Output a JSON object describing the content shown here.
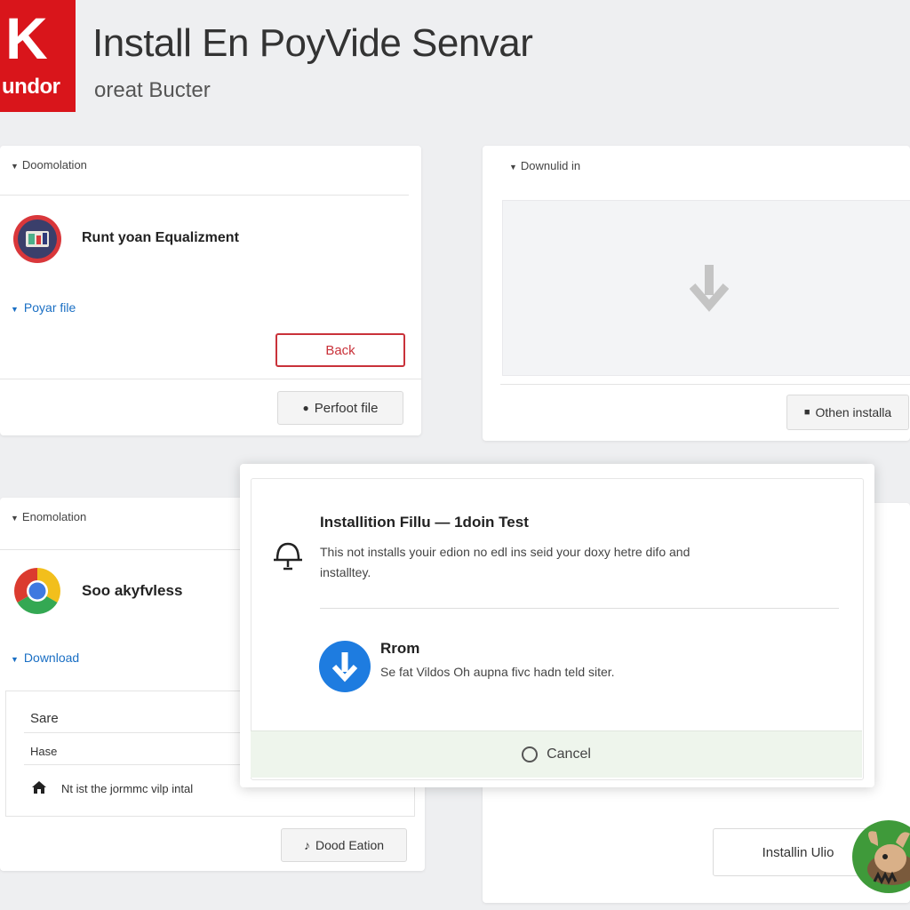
{
  "header": {
    "logo_big": "K",
    "logo_small": "undor",
    "title": "Install En PoyVide Senvar",
    "subtitle": "oreat Bucter"
  },
  "card1": {
    "section": "Doomolation",
    "item_label": "Runt yoan Equalizment",
    "link": "Poyar file",
    "back_button": "Back",
    "action_button": "Perfoot file"
  },
  "card2": {
    "section": "Downulid in",
    "button": "Othen installa"
  },
  "card3": {
    "section": "Enomolation",
    "item_label": "Soo akyfvless",
    "link": "Download",
    "list": [
      {
        "text": "Sare"
      },
      {
        "text": "Hase"
      },
      {
        "text": "Nt ist the jormmc vilp intal"
      }
    ],
    "button": "Dood Eation"
  },
  "card4": {
    "button": "Installin Ulio"
  },
  "dialog": {
    "title": "Installition Fillu — 1doin Test",
    "description": "This not installs youir edion no edl ins seid your doxy hetre difo and installtey.",
    "sub_title": "Rrom",
    "sub_description": "Se fat Vildos Oh aupna fivc hadn teld siter.",
    "cancel": "Cancel"
  },
  "colors": {
    "brand_red": "#d9151b",
    "link_blue": "#1a6fc4",
    "download_blue": "#1e7ce0"
  }
}
